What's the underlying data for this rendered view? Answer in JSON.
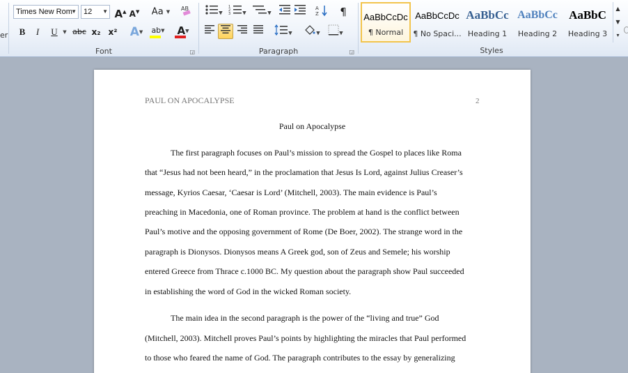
{
  "ribbon": {
    "font_group": {
      "label": "Font",
      "font_name": "Times New Rom",
      "font_size": "12",
      "grow": "A",
      "shrink": "A",
      "change_case": "Aa",
      "bold": "B",
      "italic": "I",
      "underline": "U",
      "strike": "abc",
      "subscript": "x₂",
      "superscript": "x²",
      "text_effects": "A",
      "highlight": "ab",
      "font_color": "A"
    },
    "paragraph_group": {
      "label": "Paragraph",
      "show_marks": "¶"
    },
    "styles_group": {
      "label": "Styles",
      "items": [
        {
          "preview": "AaBbCcDc",
          "name": "¶ Normal",
          "selected": true
        },
        {
          "preview": "AaBbCcDc",
          "name": "¶ No Spaci...",
          "selected": false
        },
        {
          "preview": "AaBbCc",
          "name": "Heading 1",
          "selected": false
        },
        {
          "preview": "AaBbCc",
          "name": "Heading 2",
          "selected": false
        },
        {
          "preview": "AaBbC",
          "name": "Heading 3",
          "selected": false
        }
      ]
    },
    "left_clip_text": "er"
  },
  "document": {
    "header_left": "PAUL ON APOCALYPSE",
    "header_page_number": "2",
    "title": "Paul on Apocalypse",
    "lines": [
      "The first paragraph  focuses on Paul’s mission to spread the Gospel to places like Roma",
      "that “Jesus had not been heard,” in the proclamation  that Jesus Is Lord, against Julius Creaser’s",
      "message, Kyrios Caesar, ‘Caesar is Lord’ (Mitchell,  2003). The main evidence  is Paul’s",
      "preaching  in Macedonia,  one of Roman province.  The problem at hand is the conflict  between",
      "Paul’s motive and the opposing  government  of Rome (De Boer, 2002).  The strange word in the",
      "paragraph  is Dionysos. Dionysos means  A Greek god, son of Zeus and Semele;  his worship",
      "entered Greece  from Thrace  c.1000 BC. My question  about the paragraph  show Paul succeeded",
      "in establishing  the word of God in the wicked Roman society.",
      "The main idea in the second paragraph is the power of the “living and true” God",
      "(Mitchell,  2003). Mitchell  proves Paul’s points by highlighting  the miracles  that Paul performed",
      "to those who feared the name of God. The paragraph  contributes  to the essay by generalizing"
    ]
  },
  "colors": {
    "font_color_bar": "#e02020",
    "highlight_bar": "#ffff00",
    "selected_style_border": "#f2c44c",
    "heading1": "#365f91",
    "heading2": "#4f81bd"
  }
}
